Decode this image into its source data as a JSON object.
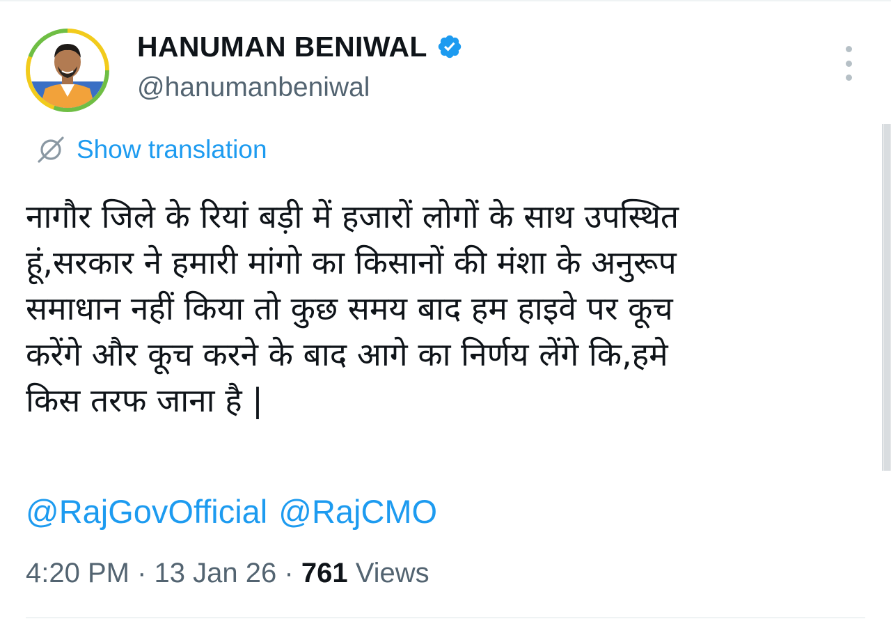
{
  "user": {
    "display_name": "HANUMAN BENIWAL",
    "handle": "@hanumanbeniwal",
    "verified": true,
    "verified_color": "#1d9bf0"
  },
  "translation": {
    "label": "Show translation",
    "icon": "translate-icon"
  },
  "tweet": {
    "lines": [
      "नागौर जिले के रियां बड़ी में हजारों लोगों के साथ उपस्थित",
      "हूं,सरकार ने हमारी मांगो का किसानों की मंशा के अनुरूप",
      "समाधान नहीं किया तो कुछ समय बाद हम हाइवे पर कूच",
      "करेंगे और कूच करने के बाद आगे का निर्णय लेंगे कि,हमे",
      "किस तरफ जाना है |"
    ],
    "mentions": [
      "@RajGovOfficial",
      "@RajCMO"
    ]
  },
  "meta": {
    "time": "4:20 PM",
    "separator": "·",
    "date": "13 Jan 26",
    "views_count": "761",
    "views_label": "Views"
  },
  "colors": {
    "link": "#1d9bf0",
    "secondary_text": "#536471",
    "primary_text": "#0f1419"
  },
  "icons": {
    "more": "more-vertical-icon",
    "verified": "verified-badge-icon"
  }
}
